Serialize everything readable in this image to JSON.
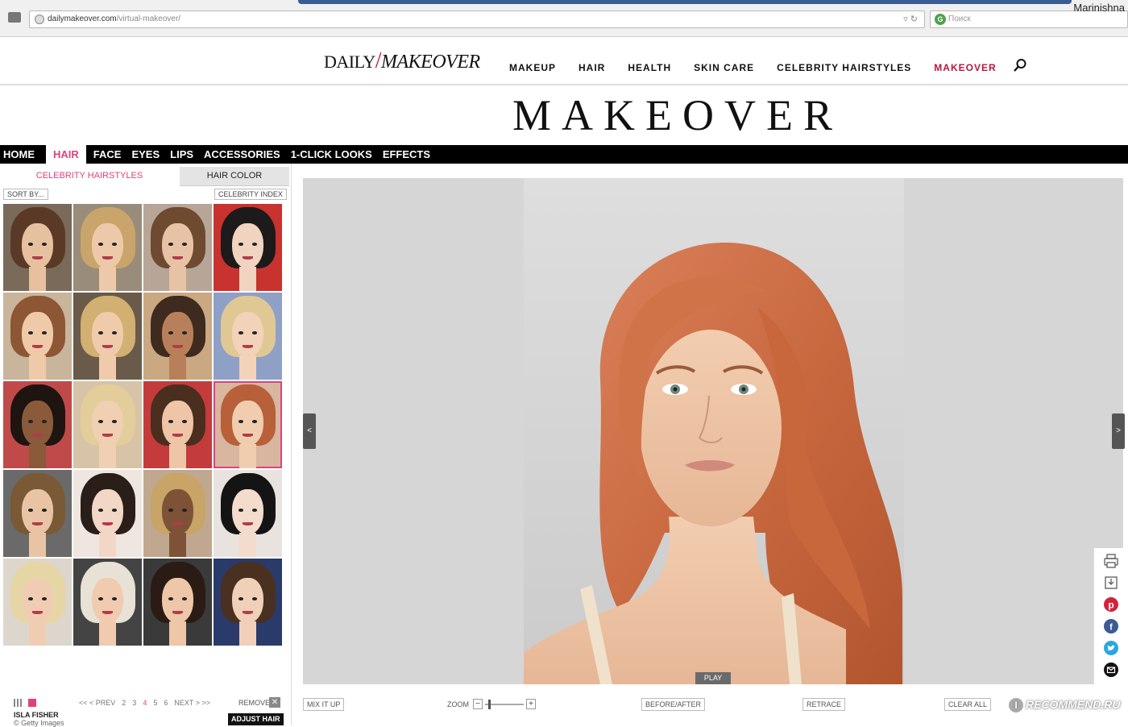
{
  "browser": {
    "url_domain": "dailymakeover.com",
    "url_path": "/virtual-makeover/",
    "search_placeholder": "Поиск",
    "user": "Marinishna"
  },
  "site": {
    "logo_daily": "DAILY",
    "logo_slash": "/",
    "logo_makeover": "MAKEOVER",
    "nav": [
      "MAKEUP",
      "HAIR",
      "HEALTH",
      "SKIN CARE",
      "CELEBRITY HAIRSTYLES",
      "MAKEOVER"
    ],
    "active_nav": "MAKEOVER",
    "title": "MAKEOVER"
  },
  "tool_nav": {
    "items": [
      "HOME",
      "HAIR",
      "FACE",
      "EYES",
      "LIPS",
      "ACCESSORIES",
      "1-CLICK LOOKS",
      "EFFECTS"
    ],
    "active": "HAIR"
  },
  "hair_panel": {
    "tab_celebrity": "CELEBRITY HAIRSTYLES",
    "tab_color": "HAIR COLOR",
    "sort_by": "SORT BY...",
    "celebrity_index": "CELEBRITY INDEX",
    "pager": {
      "prev": "<< < PREV",
      "pages": [
        "2",
        "3",
        "4",
        "5",
        "6"
      ],
      "current": "4",
      "next": "NEXT > >>"
    },
    "remove": "REMOVE",
    "remove_x": "✕",
    "selected_name": "ISLA FISHER",
    "credit": "© Getty Images",
    "adjust_hair": "ADJUST HAIR"
  },
  "viewer": {
    "prev_arrow": "<",
    "next_arrow": ">",
    "play": "PLAY"
  },
  "controls": {
    "mix_it_up": "MIX IT UP",
    "zoom": "ZOOM",
    "zoom_minus": "−",
    "zoom_plus": "+",
    "before_after": "BEFORE/AFTER",
    "retrace": "RETRACE",
    "clear_all": "CLEAR ALL",
    "zoom_level": 0.05
  },
  "share_icons": [
    "print-icon",
    "save-icon",
    "pinterest-icon",
    "facebook-icon",
    "twitter-icon",
    "email-icon"
  ],
  "watermark": {
    "mark": "I",
    "text": "RECOMMEND.RU"
  },
  "colors": {
    "accent_pink": "#e0417e",
    "brand_red": "#c0143c",
    "nav_black": "#000000"
  }
}
